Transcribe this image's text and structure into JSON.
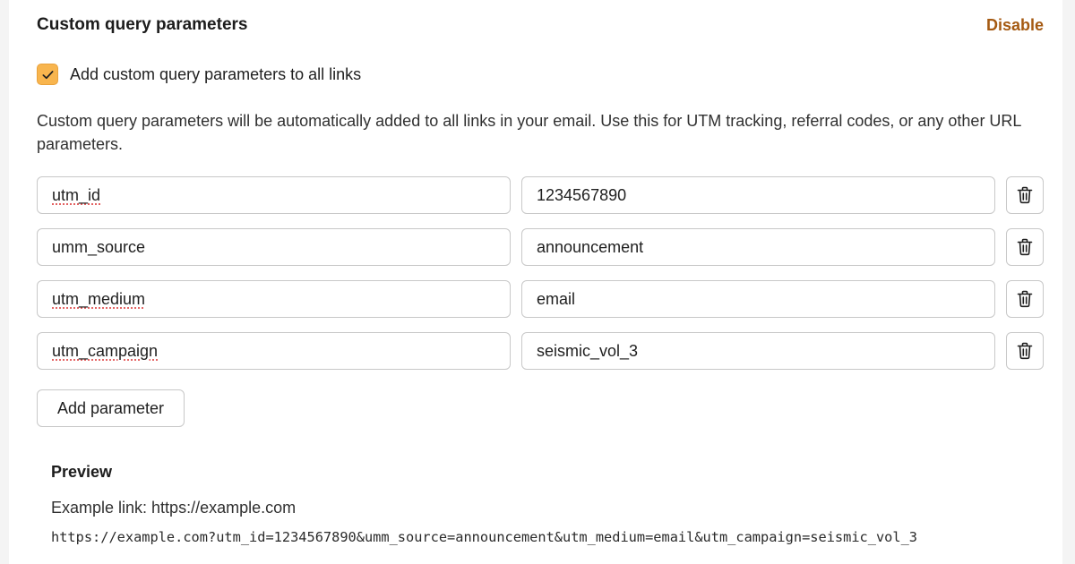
{
  "section": {
    "title": "Custom query parameters",
    "disable_label": "Disable",
    "checkbox_label": "Add custom query parameters to all links",
    "checkbox_checked": true,
    "description": "Custom query parameters will be automatically added to all links in your email. Use this for UTM tracking, referral codes, or any other URL parameters."
  },
  "params": [
    {
      "key": "utm_id",
      "value": "1234567890"
    },
    {
      "key": "umm_source",
      "value": "announcement"
    },
    {
      "key": "utm_medium",
      "value": "email"
    },
    {
      "key": "utm_campaign",
      "value": "seismic_vol_3"
    }
  ],
  "add_button_label": "Add parameter",
  "preview": {
    "title": "Preview",
    "example_label": "Example link: https://example.com",
    "url": "https://example.com?utm_id=1234567890&umm_source=announcement&utm_medium=email&utm_campaign=seismic_vol_3"
  },
  "colors": {
    "accent": "#f8b54e",
    "link": "#a55a12",
    "border": "#c8c8c8"
  },
  "icons": {
    "checkbox": "checkmark-icon",
    "delete": "trash-icon"
  }
}
